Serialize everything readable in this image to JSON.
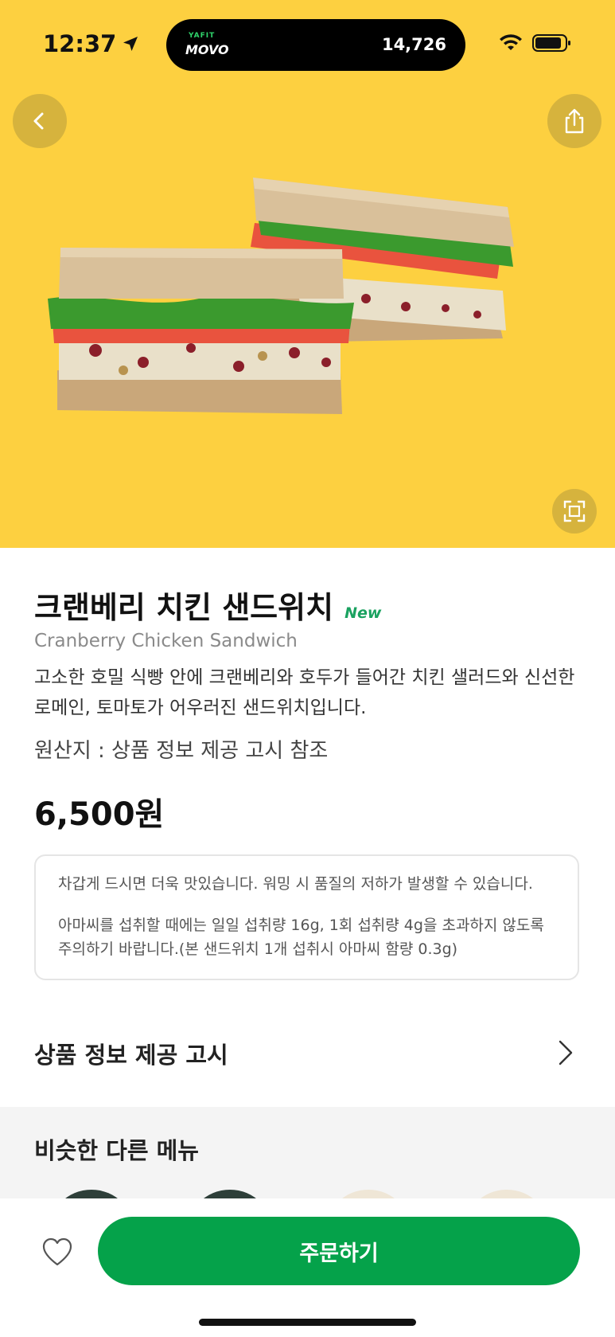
{
  "status_bar": {
    "time": "12:37",
    "island_brand_small": "YAFIT",
    "island_brand": "MOVO",
    "island_steps": "14,726"
  },
  "icons": {
    "back": "chevron-left-icon",
    "share": "share-icon",
    "zoom": "fullscreen-icon",
    "info_chevron": "chevron-right-icon",
    "favorite": "heart-icon"
  },
  "product": {
    "title": "크랜베리 치킨 샌드위치",
    "new_badge": "New",
    "english_name": "Cranberry Chicken Sandwich",
    "description": "고소한 호밀 식빵 안에 크랜베리와 호두가 들어간 치킨 샐러드와 신선한 로메인, 토마토가 어우러진 샌드위치입니다.",
    "origin": "원산지 : 상품 정보 제공 고시 참조",
    "price": "6,500원"
  },
  "notice": {
    "line1": "차갑게 드시면 더욱 맛있습니다. 워밍 시 품질의 저하가 발생할 수 있습니다.",
    "line2": "아마씨를 섭취할 때에는 일일 섭취량 16g, 1회 섭취량 4g을 초과하지 않도록 주의하기 바랍니다.(본 샌드위치 1개 섭취시 아마씨 함량 0.3g)"
  },
  "info_link": {
    "label": "상품 정보 제공 고시"
  },
  "similar": {
    "label": "비슷한 다른 메뉴"
  },
  "bottom": {
    "order_label": "주문하기"
  },
  "colors": {
    "hero_bg": "#fdd040",
    "accent_green": "#05a24a",
    "new_green": "#1aa260"
  }
}
